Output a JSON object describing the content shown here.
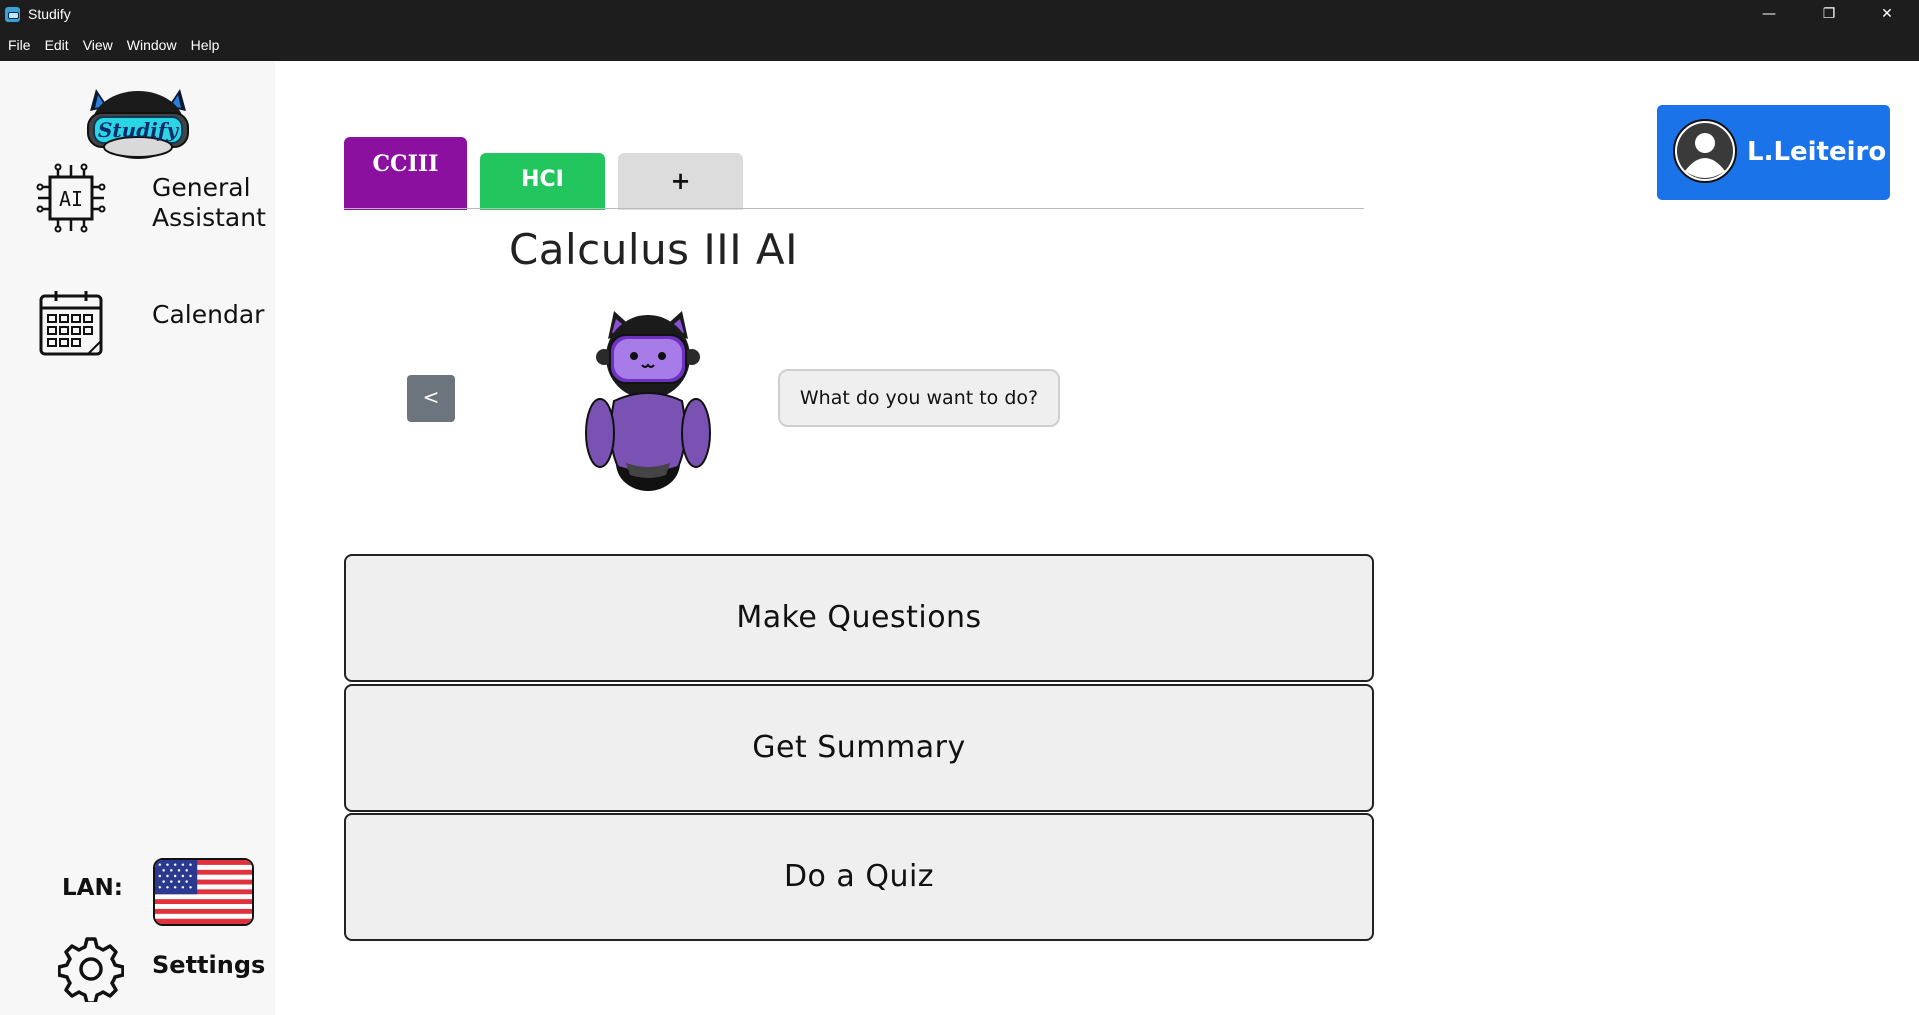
{
  "window": {
    "title": "Studify",
    "controls": {
      "minimize": "—",
      "restore": "❐",
      "close": "✕"
    }
  },
  "menu": [
    "File",
    "Edit",
    "View",
    "Window",
    "Help"
  ],
  "sidebar": {
    "items": [
      {
        "label_line1": "General",
        "label_line2": "Assistant",
        "icon": "ai-chip-icon"
      },
      {
        "label": "Calendar",
        "icon": "calendar-icon"
      }
    ],
    "language_label": "LAN:",
    "language_flag": "us-flag-icon",
    "settings_label": "Settings"
  },
  "tabs": [
    {
      "label": "CCIII",
      "color": "#8b10a0",
      "active": true
    },
    {
      "label": "HCI",
      "color": "#22c55e",
      "active": false
    },
    {
      "label": "+",
      "color": "#dcdcdc",
      "active": false
    }
  ],
  "main": {
    "title": "Calculus III AI",
    "back_label": "<",
    "prompt": "What do you want to do?",
    "actions": [
      "Make Questions",
      "Get Summary",
      "Do a Quiz"
    ]
  },
  "user": {
    "name": "L.Leiteiro",
    "accent": "#1a73e8"
  }
}
